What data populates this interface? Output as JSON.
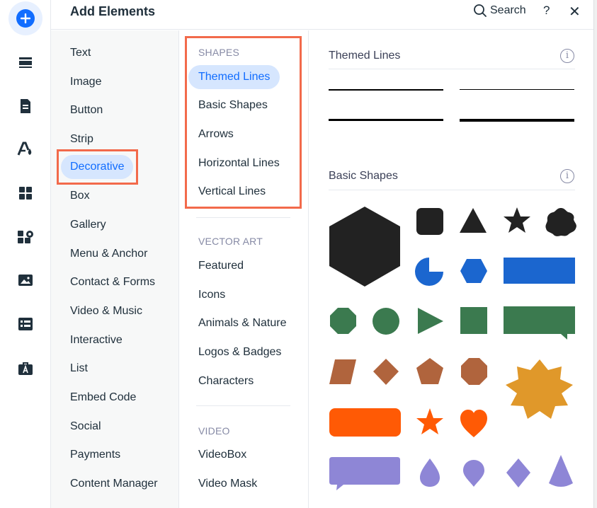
{
  "header": {
    "title": "Add Elements",
    "search_label": "Search",
    "help_label": "?",
    "close_label": "✕"
  },
  "rail": {
    "items": [
      {
        "icon": "plus-icon",
        "active": true
      },
      {
        "icon": "sections-icon"
      },
      {
        "icon": "pages-icon"
      },
      {
        "icon": "design-icon"
      },
      {
        "icon": "apps-icon"
      },
      {
        "icon": "add-apps-icon"
      },
      {
        "icon": "media-icon"
      },
      {
        "icon": "cms-icon"
      },
      {
        "icon": "portfolio-icon"
      }
    ]
  },
  "categories": {
    "items": [
      {
        "label": "Text"
      },
      {
        "label": "Image"
      },
      {
        "label": "Button"
      },
      {
        "label": "Strip"
      },
      {
        "label": "Decorative",
        "selected": true
      },
      {
        "label": "Box"
      },
      {
        "label": "Gallery"
      },
      {
        "label": "Menu & Anchor"
      },
      {
        "label": "Contact & Forms"
      },
      {
        "label": "Video & Music"
      },
      {
        "label": "Interactive"
      },
      {
        "label": "List"
      },
      {
        "label": "Embed Code"
      },
      {
        "label": "Social"
      },
      {
        "label": "Payments"
      },
      {
        "label": "Content Manager"
      }
    ]
  },
  "subcats": {
    "shapes_heading": "SHAPES",
    "shapes": [
      {
        "label": "Themed Lines",
        "selected": true
      },
      {
        "label": "Basic Shapes"
      },
      {
        "label": "Arrows"
      },
      {
        "label": "Horizontal Lines"
      },
      {
        "label": "Vertical Lines"
      }
    ],
    "vector_heading": "VECTOR ART",
    "vector": [
      {
        "label": "Featured"
      },
      {
        "label": "Icons"
      },
      {
        "label": "Animals & Nature"
      },
      {
        "label": "Logos & Badges"
      },
      {
        "label": "Characters"
      }
    ],
    "video_heading": "VIDEO",
    "video": [
      {
        "label": "VideoBox"
      },
      {
        "label": "Video Mask"
      }
    ]
  },
  "content": {
    "themed_lines_title": "Themed Lines",
    "basic_shapes_title": "Basic Shapes",
    "info_glyph": "i"
  },
  "colors": {
    "accent": "#116dff",
    "highlight_box": "#f26a4b",
    "shape_dark": "#222222",
    "shape_blue": "#1b66cf",
    "shape_green": "#3b7a4f",
    "shape_brown": "#b0643d",
    "shape_orange": "#ff5a05",
    "shape_gold": "#e0982a",
    "shape_lavender": "#8e86d6"
  }
}
